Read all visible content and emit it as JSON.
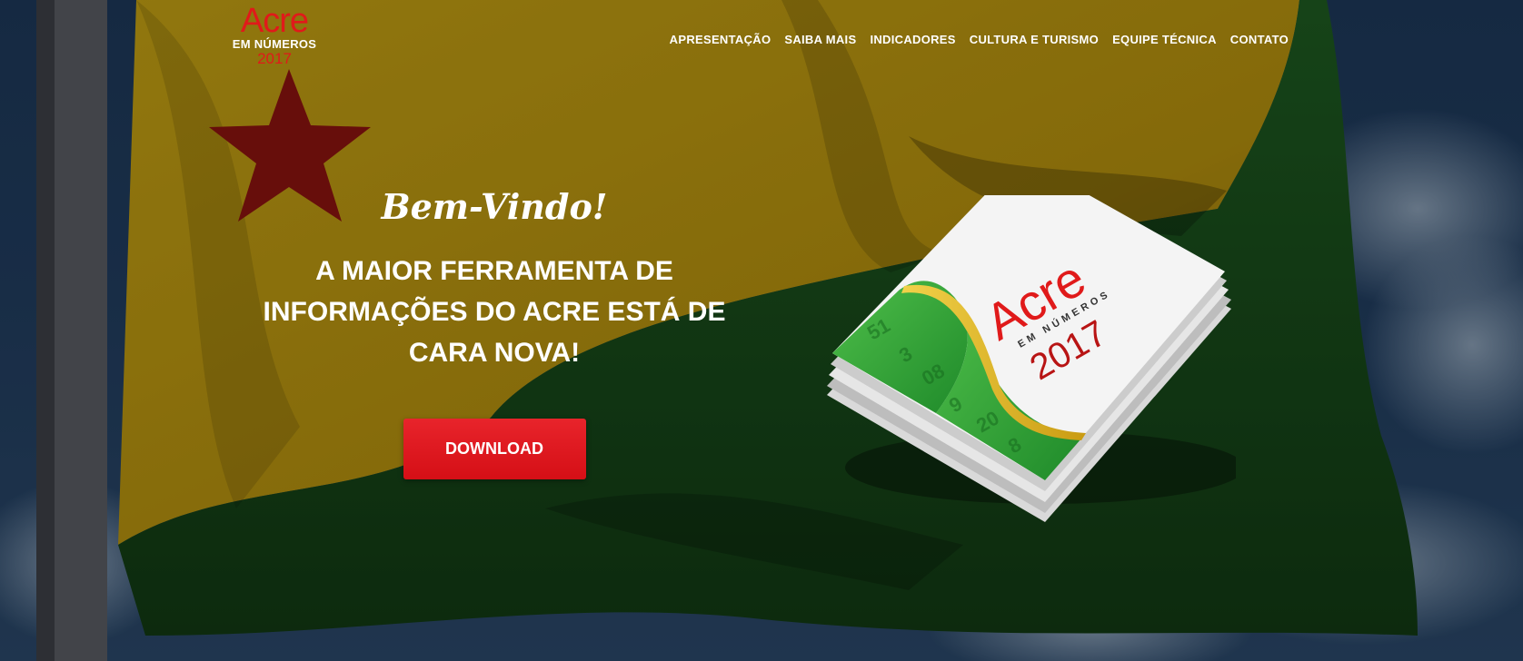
{
  "header": {
    "logo": {
      "title": "Acre",
      "subtitle": "EM NÚMEROS",
      "year": "2017"
    },
    "nav": [
      {
        "label": "APRESENTAÇÃO"
      },
      {
        "label": "SAIBA MAIS"
      },
      {
        "label": "INDICADORES"
      },
      {
        "label": "CULTURA E TURISMO"
      },
      {
        "label": "EQUIPE TÉCNICA"
      },
      {
        "label": "CONTATO"
      }
    ]
  },
  "hero": {
    "welcome": "Bem-Vindo!",
    "headline": "A MAIOR FERRAMENTA DE INFORMAÇÕES DO ACRE ESTÁ DE CARA NOVA!",
    "download_label": "DOWNLOAD"
  },
  "book": {
    "title": "Acre",
    "subtitle": "EM NÚMEROS",
    "year": "2017"
  },
  "colors": {
    "accent_red": "#e01a1a",
    "flag_yellow": "#c9a816",
    "flag_green": "#1d5a1e",
    "sky": "#223f62"
  }
}
